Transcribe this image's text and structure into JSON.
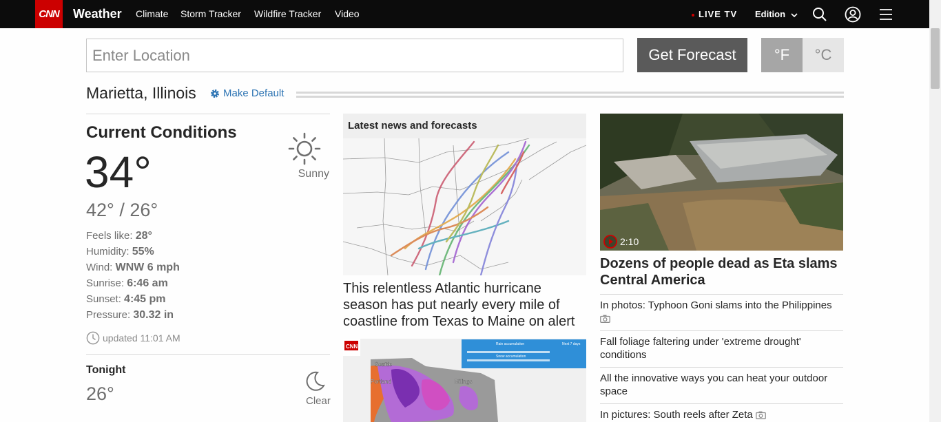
{
  "nav": {
    "logo": "CNN",
    "section": "Weather",
    "links": [
      "Climate",
      "Storm Tracker",
      "Wildfire Tracker",
      "Video"
    ],
    "live_tv": "LIVE TV",
    "edition": "Edition",
    "icons": [
      "search-icon",
      "account-icon",
      "menu-icon"
    ]
  },
  "search": {
    "placeholder": "Enter Location",
    "button": "Get Forecast",
    "unit_f": "°F",
    "unit_c": "°C"
  },
  "location": {
    "name": "Marietta, Illinois",
    "make_default": "Make Default"
  },
  "current": {
    "title": "Current Conditions",
    "condition": "Sunny",
    "icon": "sun-icon",
    "temp": "34°",
    "hilo": "42° / 26°",
    "stats": [
      {
        "label": "Feels like: ",
        "value": "28°"
      },
      {
        "label": "Humidity: ",
        "value": "55%"
      },
      {
        "label": "Wind: ",
        "value": "WNW 6 mph"
      },
      {
        "label": "Sunrise: ",
        "value": "6:46 am"
      },
      {
        "label": "Sunset: ",
        "value": "4:45 pm"
      },
      {
        "label": "Pressure: ",
        "value": "30.32 in"
      }
    ],
    "updated": "updated 11:01 AM"
  },
  "tonight": {
    "title": "Tonight",
    "temp": "26°",
    "condition": "Clear",
    "icon": "moon-icon"
  },
  "news": {
    "header": "Latest news and forecasts",
    "headline": "This relentless Atlantic hurricane season has put nearly every mile of coastline from Texas to Maine on alert",
    "snow_map": {
      "logo": "CNN",
      "labels": [
        "Seattle",
        "Portland",
        "Billings"
      ],
      "legend_rain": "Rain accumulation",
      "legend_snow": "Snow accumulation",
      "legend_days": "Next 7 days"
    }
  },
  "featured": {
    "duration": "2:10",
    "headline": "Dozens of people dead as Eta slams Central America",
    "related": [
      {
        "text": "In photos: Typhoon Goni slams into the Philippines",
        "camera": true
      },
      {
        "text": "Fall foliage faltering under 'extreme drought' conditions",
        "camera": false
      },
      {
        "text": "All the innovative ways you can heat your outdoor space",
        "camera": false
      },
      {
        "text": "In pictures: South reels after Zeta",
        "camera": true
      }
    ]
  },
  "colors": {
    "brand_red": "#cc0000",
    "link_blue": "#2d74b3",
    "nav_bg": "#0c0c0c"
  }
}
